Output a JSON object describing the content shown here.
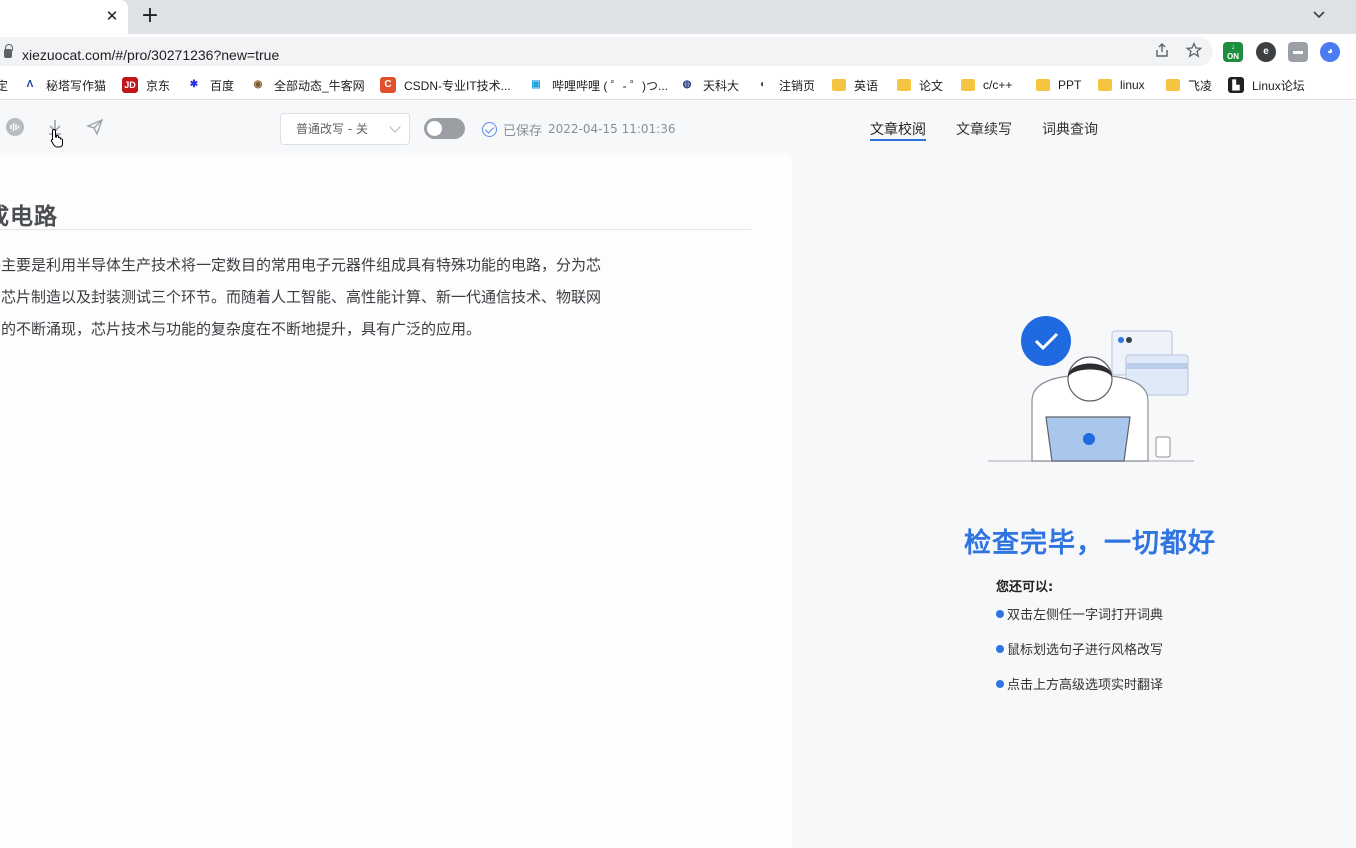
{
  "browser": {
    "tab_close": "✕",
    "new_tab": "+",
    "url_host": "xiezuocat.com",
    "url_path": "/#/pro/30271236?new=true"
  },
  "bookmarks": [
    {
      "label": "定",
      "color": "#202124"
    },
    {
      "label": "秘塔写作猫",
      "icon": "Ʌ",
      "color": "#1a3fa0"
    },
    {
      "label": "京东",
      "icon": "JD",
      "color": "#c0151b"
    },
    {
      "label": "百度",
      "icon": "✱",
      "color": "#2932e1"
    },
    {
      "label": "全部动态_牛客网",
      "icon": "◉",
      "color": "#7a5a2a"
    },
    {
      "label": "CSDN-专业IT技术...",
      "icon": "C",
      "color": "#e0502a"
    },
    {
      "label": "哔哩哔哩 ( ゜- ゜)つ...",
      "icon": "▣",
      "color": "#1aa3e0"
    },
    {
      "label": "天科大",
      "icon": "◍",
      "color": "#233a7a"
    },
    {
      "label": "注销页",
      "icon": "◐",
      "color": "#444"
    },
    {
      "label": "英语",
      "folder": true
    },
    {
      "label": "论文",
      "folder": true
    },
    {
      "label": "c/c++",
      "folder": true
    },
    {
      "label": "PPT",
      "folder": true
    },
    {
      "label": "linux",
      "folder": true
    },
    {
      "label": "飞凌",
      "folder": true
    },
    {
      "label": "Linux论坛",
      "icon": "▙",
      "color": "#202124"
    }
  ],
  "editor": {
    "mode_label": "普通改写 - 关",
    "saved_label": "已保存",
    "saved_time": "2022-04-15 11:01:36",
    "title": "成电路",
    "body_lines": [
      "路主要是利用半导体生产技术将一定数目的常用电子元器件组成具有特殊功能的电路，分为芯",
      "、芯片制造以及封装测试三个环节。而随着人工智能、高性能计算、新一代通信技术、物联网",
      "用的不断涌现，芯片技术与功能的复杂度在不断地提升，具有广泛的应用。"
    ]
  },
  "side": {
    "tabs": [
      "文章校阅",
      "文章续写",
      "词典查询"
    ],
    "active_tab": 0,
    "done_title": "检查完毕，一切都好",
    "hint_head": "您还可以:",
    "hints": [
      "双击左侧任一字词打开词典",
      "鼠标划选句子进行风格改写",
      "点击上方高级选项实时翻译"
    ],
    "accent": "#2f74e0"
  }
}
